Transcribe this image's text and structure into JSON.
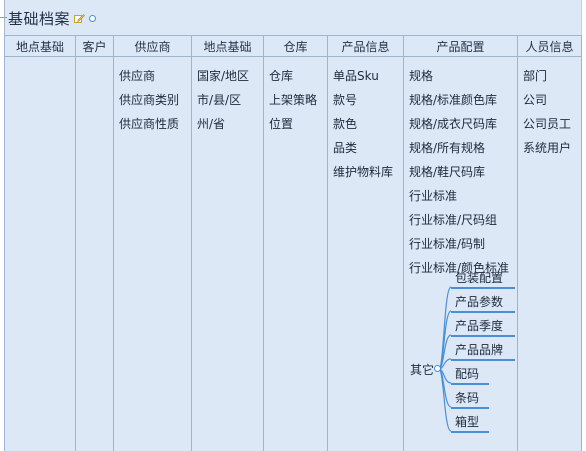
{
  "title": "基础档案",
  "columns": [
    {
      "key": "loc1",
      "header": "地点基础",
      "items": []
    },
    {
      "key": "customer",
      "header": "客户",
      "items": []
    },
    {
      "key": "supplier",
      "header": "供应商",
      "items": [
        "供应商",
        "供应商类别",
        "供应商性质"
      ]
    },
    {
      "key": "loc2",
      "header": "地点基础",
      "items": [
        "国家/地区",
        "市/县/区",
        "州/省"
      ]
    },
    {
      "key": "warehouse",
      "header": "仓库",
      "items": [
        "仓库",
        "上架策略",
        "位置"
      ]
    },
    {
      "key": "product",
      "header": "产品信息",
      "items": [
        "单品Sku",
        "款号",
        "款色",
        "品类",
        "维护物料库"
      ]
    },
    {
      "key": "config",
      "header": "产品配置",
      "items": [
        "规格",
        "规格/标准颜色库",
        "规格/成衣尺码库",
        "规格/所有规格",
        "规格/鞋尺码库",
        "行业标准",
        "行业标准/尺码组",
        "行业标准/码制",
        "行业标准/颜色标准"
      ]
    },
    {
      "key": "people",
      "header": "人员信息",
      "items": [
        "部门",
        "公司",
        "公司员工",
        "系统用户"
      ]
    }
  ],
  "other": {
    "label": "其它",
    "items": [
      "包装配置",
      "产品参数",
      "产品季度",
      "产品品牌",
      "配码",
      "条码",
      "箱型"
    ]
  }
}
